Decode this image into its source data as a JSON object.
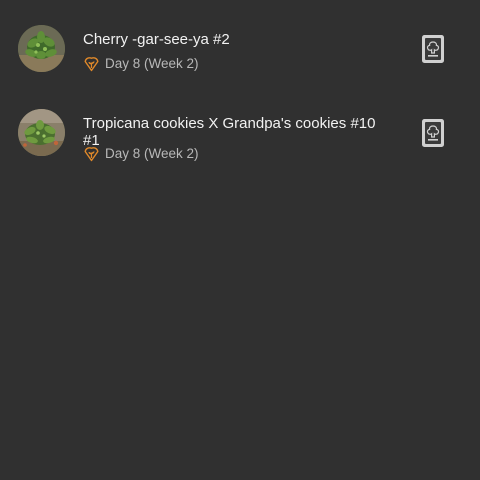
{
  "plants": [
    {
      "name": "Cherry -gar-see-ya #2",
      "age": "Day 8 (Week 2)",
      "stage_icon": "sprout-stage-icon",
      "action_icon": "grow-diary-icon"
    },
    {
      "name": "Tropicana cookies X Grandpa's cookies #10 #1",
      "age": "Day 8 (Week 2)",
      "stage_icon": "sprout-stage-icon",
      "action_icon": "grow-diary-icon"
    }
  ],
  "colors": {
    "background": "#303030",
    "text_primary": "#f2f2f2",
    "text_secondary": "#b8b8b8",
    "stage_accent": "#e0892a",
    "action_icon": "#cfcfcf"
  }
}
